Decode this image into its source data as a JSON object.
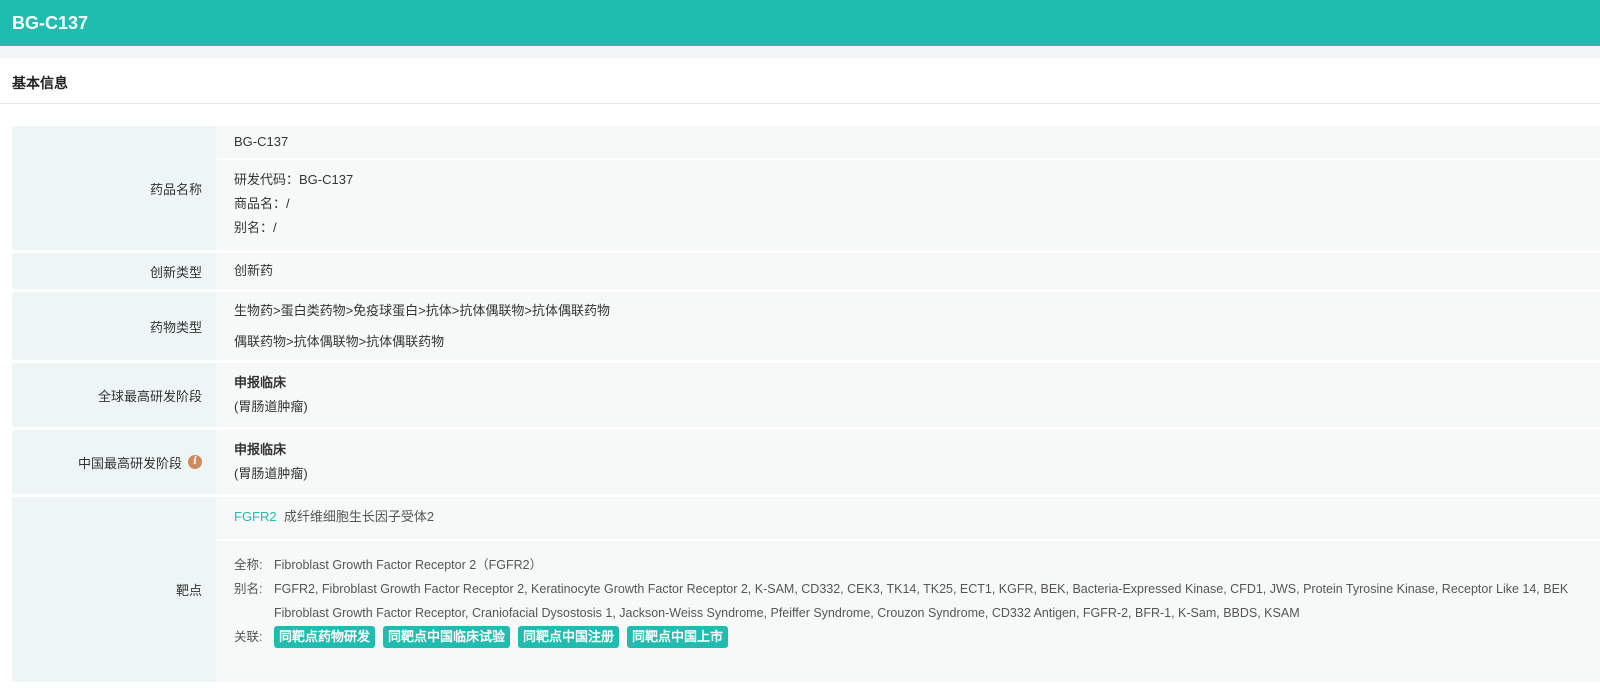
{
  "header": {
    "title": "BG-C137"
  },
  "section": {
    "title": "基本信息"
  },
  "rows": {
    "name": {
      "label": "药品名称",
      "primary": "BG-C137",
      "code": "研发代码：BG-C137",
      "trade": "商品名：/",
      "alias": "别名：/"
    },
    "innovation": {
      "label": "创新类型",
      "value": "创新药"
    },
    "drug_type": {
      "label": "药物类型",
      "line1": "生物药>蛋白类药物>免疫球蛋白>抗体>抗体偶联物>抗体偶联药物",
      "line2": "偶联药物>抗体偶联物>抗体偶联药物"
    },
    "global_stage": {
      "label": "全球最高研发阶段",
      "stage": "申报临床",
      "indication": "(胃肠道肿瘤)"
    },
    "china_stage": {
      "label": "中国最高研发阶段",
      "info_icon": "i",
      "stage": "申报临床",
      "indication": "(胃肠道肿瘤)"
    },
    "target": {
      "label": "靶点",
      "symbol": "FGFR2",
      "cn_name": "成纤维细胞生长因子受体2",
      "fullname_key": "全称:",
      "fullname": "Fibroblast Growth Factor Receptor 2（FGFR2）",
      "alias_key": "别名:",
      "alias": "FGFR2, Fibroblast Growth Factor Receptor 2, Keratinocyte Growth Factor Receptor 2, K-SAM, CD332, CEK3, TK14, TK25, ECT1, KGFR, BEK, Bacteria-Expressed Kinase, CFD1, JWS, Protein Tyrosine Kinase, Receptor Like 14, BEK Fibroblast Growth Factor Receptor, Craniofacial Dysostosis 1, Jackson-Weiss Syndrome, Pfeiffer Syndrome, Crouzon Syndrome, CD332 Antigen, FGFR-2, BFR-1, K-Sam, BBDS, KSAM",
      "related_key": "关联:",
      "related": [
        "同靶点药物研发",
        "同靶点中国临床试验",
        "同靶点中国注册",
        "同靶点中国上市"
      ]
    }
  }
}
